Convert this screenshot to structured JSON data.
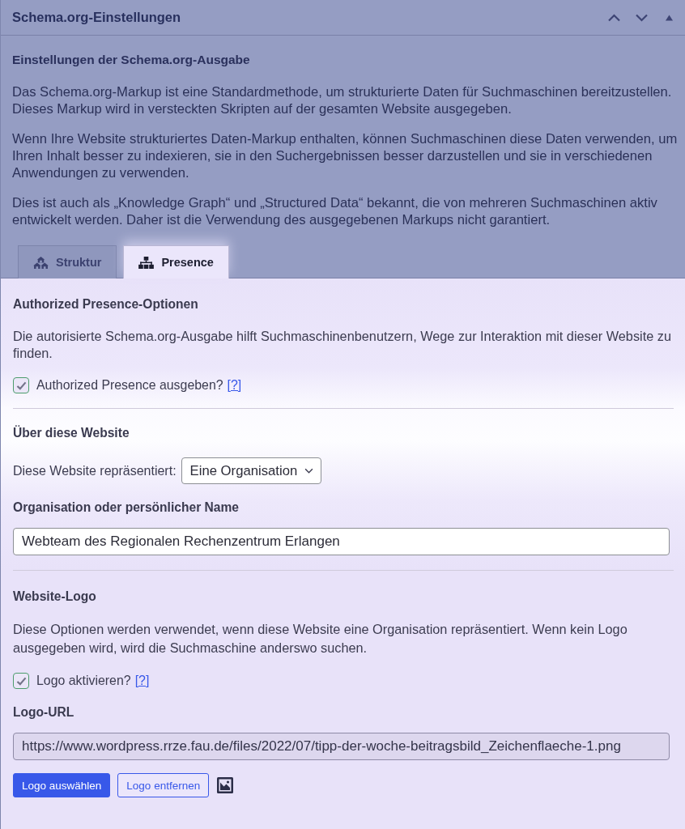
{
  "panel": {
    "title": "Schema.org-Einstellungen",
    "expanded": true
  },
  "intro": {
    "heading": "Einstellungen der Schema.org-Ausgabe",
    "paragraphs": [
      "Das Schema.org-Markup ist eine Standardmethode, um strukturierte Daten für Suchmaschinen bereitzustellen. Dieses Markup wird in versteckten Skripten auf der gesamten Website ausgegeben.",
      "Wenn Ihre Website strukturiertes Daten-Markup enthalten, können Suchmaschinen diese Daten verwenden, um Ihren Inhalt besser zu indexieren, sie in den Suchergebnissen besser darzustellen und sie in verschiedenen Anwendungen zu verwenden.",
      "Dies ist auch als „Knowledge Graph“ und „Structured Data“ bekannt, die von mehreren Suchmaschinen aktiv entwickelt werden. Daher ist die Verwendung des ausgegebenen Markups nicht garantiert."
    ]
  },
  "tabs": [
    {
      "label": "Struktur",
      "selected": false
    },
    {
      "label": "Presence",
      "selected": true
    }
  ],
  "sections": [
    {
      "heading": "Authorized Presence-Optionen",
      "items": [
        {
          "kind": "paragraph",
          "text": "Die autorisierte Schema.org-Ausgabe hilft Suchmaschinenbenutzern, Wege zur Interaktion mit dieser Website zu finden."
        },
        {
          "kind": "checkbox",
          "label": "Authorized Presence ausgeben?",
          "checked": true,
          "help": "[?]"
        }
      ]
    },
    {
      "heading": "Über diese Website",
      "items": [
        {
          "kind": "select",
          "label": "Diese Website repräsentiert:",
          "value": "Eine Organisation"
        },
        {
          "kind": "label",
          "text": "Organisation oder persönlicher Name"
        },
        {
          "kind": "text_field",
          "value": "Webteam des Regionalen Rechenzentrum Erlangen",
          "disabled": false
        }
      ]
    },
    {
      "heading": "Website-Logo",
      "items": [
        {
          "kind": "paragraph",
          "text": "Diese Optionen werden verwendet, wenn diese Website eine Organisation repräsentiert. Wenn kein Logo ausgegeben wird, wird die Suchmaschine anderswo suchen."
        },
        {
          "kind": "checkbox",
          "label": "Logo aktivieren?",
          "checked": true,
          "help": "[?]"
        },
        {
          "kind": "label",
          "text": "Logo-URL"
        },
        {
          "kind": "text_field",
          "value": "https://www.wordpress.rrze.fau.de/files/2022/07/tipp-der-woche-beitragsbild_Zeichenflaeche-1.png",
          "disabled": true
        },
        {
          "kind": "buttons",
          "buttons": [
            {
              "kind": "primary",
              "label": "Logo auswählen"
            },
            {
              "kind": "secondary",
              "label": "Logo entfernen"
            }
          ]
        }
      ]
    }
  ]
}
